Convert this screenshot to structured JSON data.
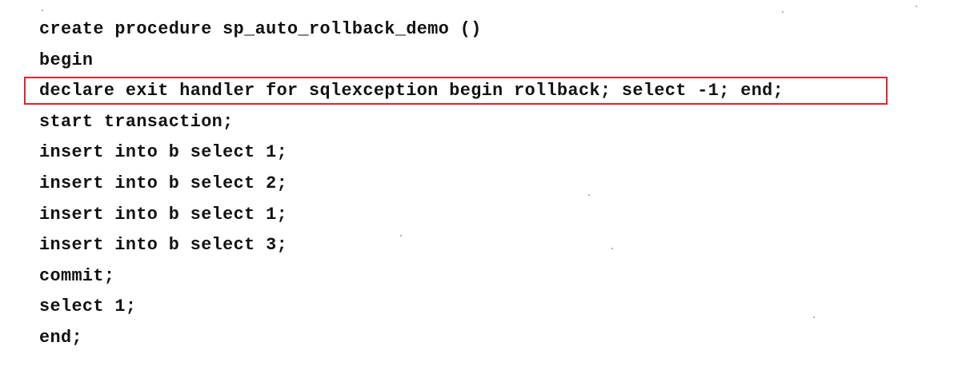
{
  "code": {
    "lines": [
      "create procedure sp_auto_rollback_demo ()",
      "begin",
      "declare exit handler for sqlexception begin rollback; select -1; end;",
      "start transaction;",
      "insert into b select 1;",
      "insert into b select 2;",
      "insert into b select 1;",
      "insert into b select 3;",
      "commit;",
      "select 1;",
      "end;"
    ],
    "highlighted_line_index": 2
  },
  "colors": {
    "highlight_border": "#e0242a",
    "text": "#111111",
    "background": "#ffffff"
  }
}
